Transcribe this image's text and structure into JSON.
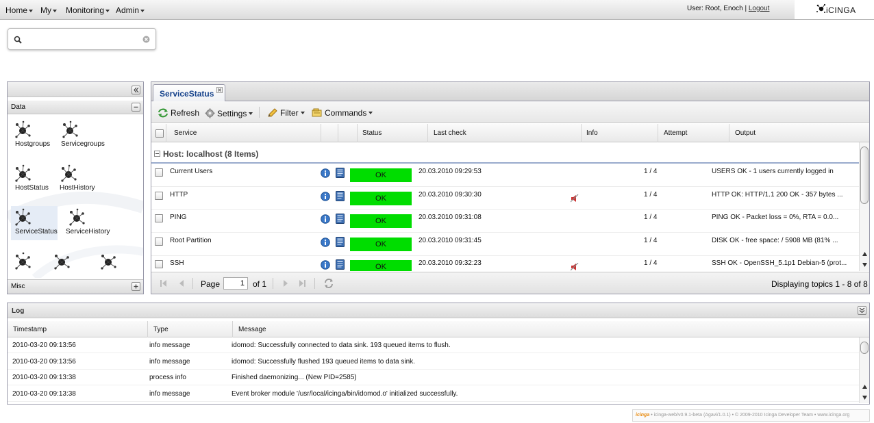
{
  "topbar": {
    "menus": [
      "Home",
      "My",
      "Monitoring",
      "Admin"
    ],
    "user_text": "User: Root, Enoch |",
    "logout_label": "Logout",
    "logo_text": "iCINGA"
  },
  "search": {
    "value": "",
    "placeholder": ""
  },
  "left_panel": {
    "data_section_title": "Data",
    "misc_section_title": "Misc",
    "items": [
      "Hostgroups",
      "Servicegroups",
      "HostStatus",
      "HostHistory",
      "ServiceStatus",
      "ServiceHistory"
    ],
    "selected_item": "ServiceStatus"
  },
  "main": {
    "tab_label": "ServiceStatus",
    "toolbar": {
      "refresh": "Refresh",
      "settings": "Settings",
      "filter": "Filter",
      "commands": "Commands"
    },
    "columns": [
      "Service",
      "Status",
      "Last check",
      "Info",
      "Attempt",
      "Output"
    ],
    "group_label": "Host: localhost (8 Items)",
    "rows": [
      {
        "service": "Current Users",
        "status": "OK",
        "last_check": "20.03.2010 09:29:53",
        "attempt": "1 / 4",
        "output": "USERS OK - 1 users currently logged in",
        "notif_disabled": false
      },
      {
        "service": "HTTP",
        "status": "OK",
        "last_check": "20.03.2010 09:30:30",
        "attempt": "1 / 4",
        "output": "HTTP OK: HTTP/1.1 200 OK - 357 bytes ...",
        "notif_disabled": true
      },
      {
        "service": "PING",
        "status": "OK",
        "last_check": "20.03.2010 09:31:08",
        "attempt": "1 / 4",
        "output": "PING OK - Packet loss = 0%, RTA = 0.0...",
        "notif_disabled": false
      },
      {
        "service": "Root Partition",
        "status": "OK",
        "last_check": "20.03.2010 09:31:45",
        "attempt": "1 / 4",
        "output": "DISK OK - free space: / 5908 MB (81% ...",
        "notif_disabled": false
      },
      {
        "service": "SSH",
        "status": "OK",
        "last_check": "20.03.2010 09:32:23",
        "attempt": "1 / 4",
        "output": "SSH OK - OpenSSH_5.1p1 Debian-5 (prot...",
        "notif_disabled": true
      }
    ],
    "paging": {
      "page_label": "Page",
      "page_value": "1",
      "of_label": "of 1",
      "display_text": "Displaying topics 1 - 8 of 8"
    }
  },
  "log": {
    "title": "Log",
    "columns": [
      "Timestamp",
      "Type",
      "Message"
    ],
    "rows": [
      {
        "timestamp": "2010-03-20 09:13:56",
        "type": "info message",
        "message": "idomod: Successfully connected to data sink. 193 queued items to flush."
      },
      {
        "timestamp": "2010-03-20 09:13:56",
        "type": "info message",
        "message": "idomod: Successfully flushed 193 queued items to data sink."
      },
      {
        "timestamp": "2010-03-20 09:13:38",
        "type": "process info",
        "message": "Finished daemonizing... (New PID=2585)"
      },
      {
        "timestamp": "2010-03-20 09:13:38",
        "type": "info message",
        "message": "Event broker module '/usr/local/icinga/bin/idomod.o' initialized successfully."
      }
    ]
  },
  "footer": {
    "brand": "icinga",
    "text": "• icinga-web/v0.9.1-beta (Agavi/1.0.1) • © 2009-2010 Icinga Developer Team • www.icinga.org"
  },
  "colors": {
    "ok_status": "#00dd00",
    "info_icon": "#3a78c8",
    "notification_disabled": "#cc3333",
    "refresh_icon": "#3a9a3a"
  }
}
